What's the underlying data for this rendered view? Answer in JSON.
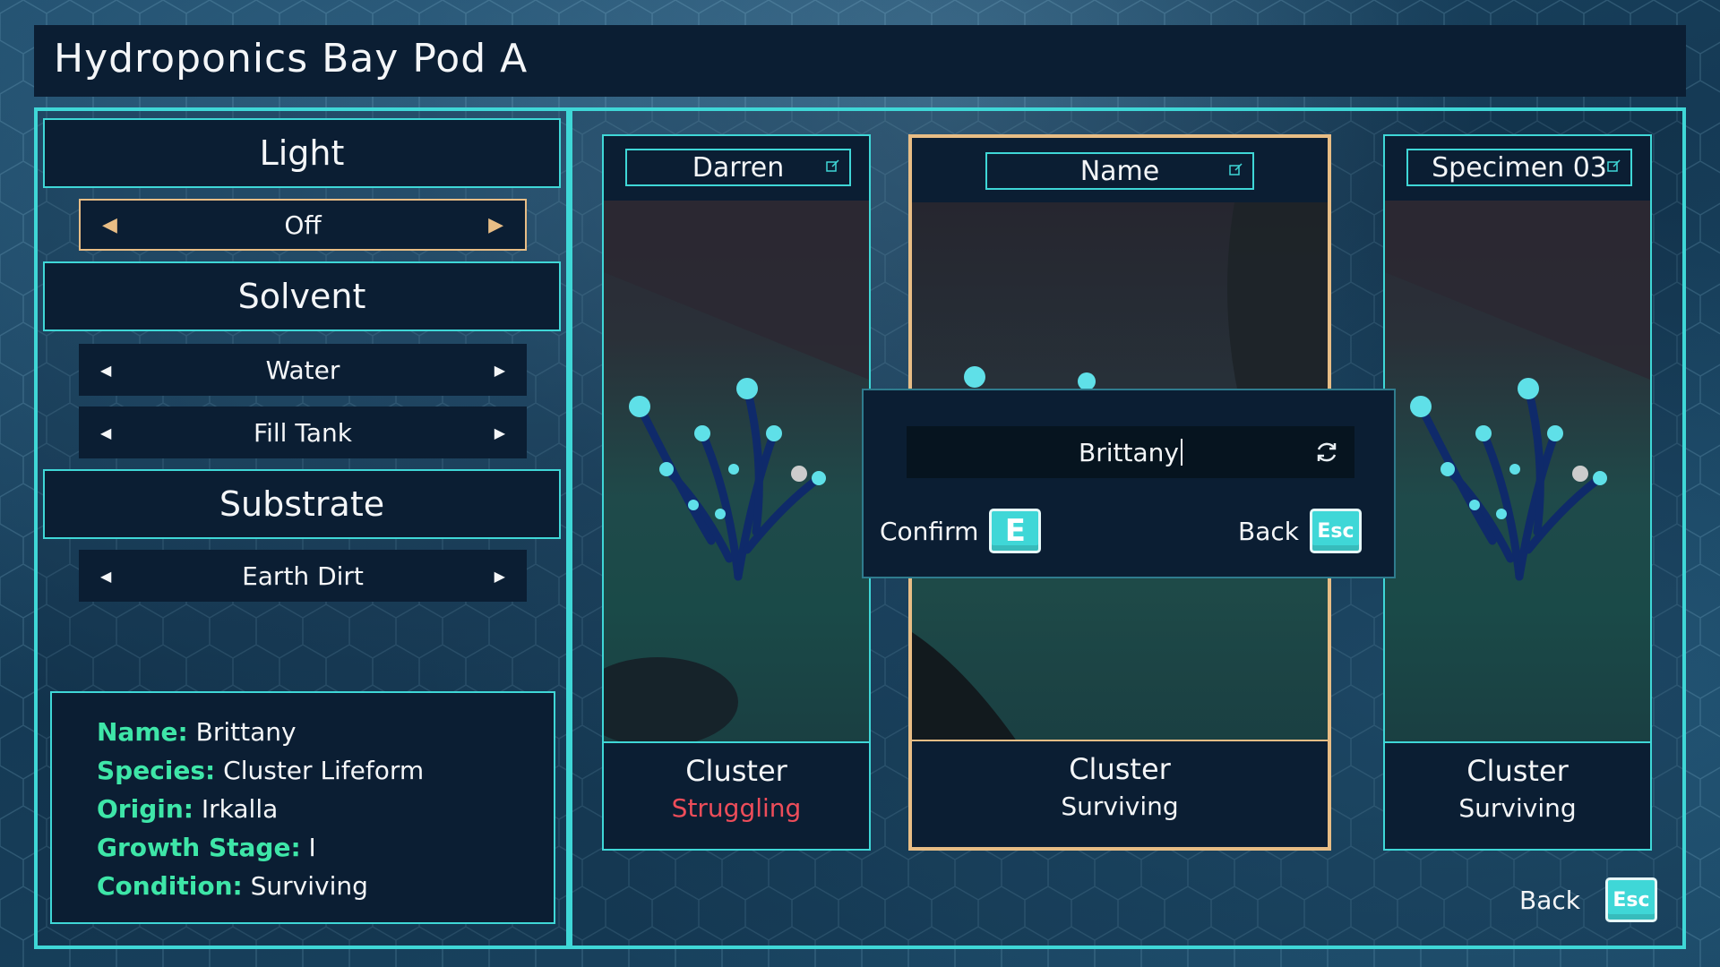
{
  "title": "Hydroponics Bay Pod A",
  "left_panel": {
    "sections": {
      "light": {
        "label": "Light",
        "value": "Off"
      },
      "solvent": {
        "label": "Solvent",
        "value": "Water",
        "action": "Fill Tank"
      },
      "substrate": {
        "label": "Substrate",
        "value": "Earth Dirt"
      }
    },
    "info": {
      "name_label": "Name:",
      "name_value": "Brittany",
      "species_label": "Species:",
      "species_value": "Cluster Lifeform",
      "origin_label": "Origin:",
      "origin_value": "Irkalla",
      "stage_label": "Growth Stage:",
      "stage_value": "I",
      "condition_label": "Condition:",
      "condition_value": "Surviving"
    }
  },
  "cards": [
    {
      "name": "Darren",
      "type": "Cluster",
      "status": "Struggling"
    },
    {
      "name": "Name",
      "type": "Cluster",
      "status": "Surviving"
    },
    {
      "name": "Specimen 03",
      "type": "Cluster",
      "status": "Surviving"
    }
  ],
  "rename_dialog": {
    "input_value": "Brittany",
    "confirm_label": "Confirm",
    "confirm_key": "E",
    "back_label": "Back",
    "back_key": "Esc"
  },
  "footer": {
    "back_label": "Back",
    "back_key": "Esc"
  },
  "colors": {
    "accent": "#3fd7d7",
    "highlight": "#e8bd85",
    "label_green": "#3ee6a8",
    "warning": "#ee4d5a",
    "panel": "#0b1e33"
  },
  "icons": [
    "edit-icon",
    "refresh-icon",
    "arrow-left-icon",
    "arrow-right-icon",
    "key-e-icon",
    "key-esc-icon"
  ]
}
